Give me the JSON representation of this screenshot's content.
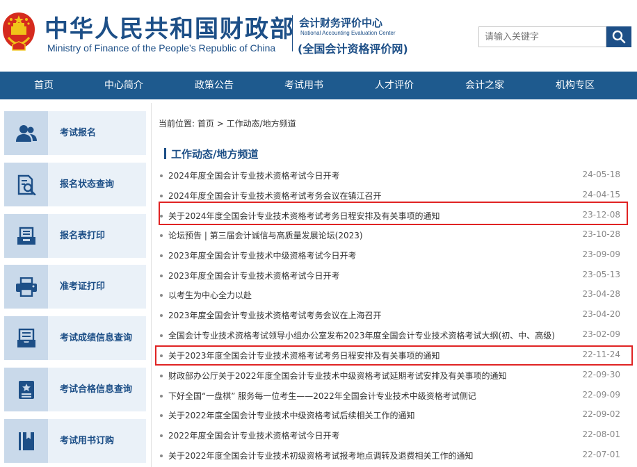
{
  "header": {
    "ministry_cn": "中华人民共和国财政部",
    "ministry_en": "Ministry of Finance of the People’s Republic of China",
    "center_cn": "会计财务评价中心",
    "center_en": "National Accounting Evaluation Center",
    "center_sub": "(全国会计资格评价网)",
    "search_placeholder": "请输入关键字",
    "brand_color": "#1d4f87"
  },
  "nav": {
    "items": [
      {
        "label": "首页"
      },
      {
        "label": "中心简介"
      },
      {
        "label": "政策公告"
      },
      {
        "label": "考试用书"
      },
      {
        "label": "人才评价"
      },
      {
        "label": "会计之家"
      },
      {
        "label": "机构专区"
      }
    ],
    "bg_color": "#1e5a8e"
  },
  "sidebar": {
    "items": [
      {
        "label": "考试报名",
        "icon": "users-icon"
      },
      {
        "label": "报名状态查询",
        "icon": "document-search-icon"
      },
      {
        "label": "报名表打印",
        "icon": "tray-icon"
      },
      {
        "label": "准考证打印",
        "icon": "printer-icon"
      },
      {
        "label": "考试成绩信息查询",
        "icon": "inbox-icon"
      },
      {
        "label": "考试合格信息查询",
        "icon": "certificate-icon"
      },
      {
        "label": "考试用书订购",
        "icon": "book-icon"
      }
    ]
  },
  "breadcrumb": {
    "prefix": "当前位置:",
    "home": "首页",
    "separator": ">",
    "current": "工作动态/地方频道"
  },
  "section": {
    "title": "工作动态/地方频道"
  },
  "news": [
    {
      "title": "2024年度全国会计专业技术资格考试今日开考",
      "date": "24-05-18"
    },
    {
      "title": "2024年度全国会计专业技术资格考试考务会议在镇江召开",
      "date": "24-04-15"
    },
    {
      "title": "关于2024年度全国会计专业技术资格考试考务日程安排及有关事项的通知",
      "date": "23-12-08",
      "highlighted": true
    },
    {
      "title": "论坛预告 | 第三届会计诚信与高质量发展论坛(2023)",
      "date": "23-10-28"
    },
    {
      "title": "2023年度全国会计专业技术中级资格考试今日开考",
      "date": "23-09-09"
    },
    {
      "title": "2023年度全国会计专业技术资格考试今日开考",
      "date": "23-05-13"
    },
    {
      "title": "以考生为中心全力以赴",
      "date": "23-04-28"
    },
    {
      "title": "2023年度全国会计专业技术资格考试考务会议在上海召开",
      "date": "23-04-20"
    },
    {
      "title": "全国会计专业技术资格考试领导小组办公室发布2023年度全国会计专业技术资格考试大纲(初、中、高级)",
      "date": "23-02-09"
    },
    {
      "title": "关于2023年度全国会计专业技术资格考试考务日程安排及有关事项的通知",
      "date": "22-11-24",
      "highlighted": true
    },
    {
      "title": "财政部办公厅关于2022年度全国会计专业技术中级资格考试延期考试安排及有关事项的通知",
      "date": "22-09-30"
    },
    {
      "title": "下好全国“一盘棋” 服务每一位考生——2022年全国会计专业技术中级资格考试侧记",
      "date": "22-09-09"
    },
    {
      "title": "关于2022年度全国会计专业技术中级资格考试后续相关工作的通知",
      "date": "22-09-02"
    },
    {
      "title": "2022年度全国会计专业技术资格考试今日开考",
      "date": "22-08-01"
    },
    {
      "title": "关于2022年度全国会计专业技术初级资格考试报考地点调转及退费相关工作的通知",
      "date": "22-07-01"
    }
  ],
  "highlight_color": "#e02323"
}
